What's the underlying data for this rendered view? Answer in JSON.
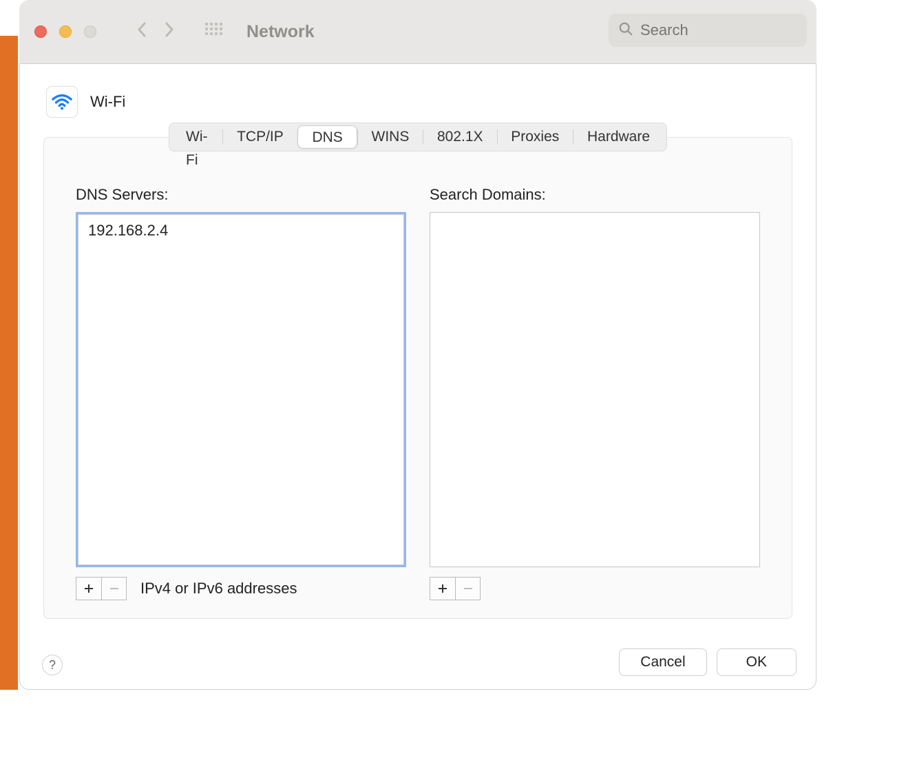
{
  "window": {
    "title": "Network",
    "search_placeholder": "Search"
  },
  "header": {
    "interface_label": "Wi-Fi"
  },
  "tabs": [
    "Wi-Fi",
    "TCP/IP",
    "DNS",
    "WINS",
    "802.1X",
    "Proxies",
    "Hardware"
  ],
  "active_tab_index": 2,
  "dns": {
    "servers_label": "DNS Servers:",
    "servers": [
      "192.168.2.4"
    ],
    "hint": "IPv4 or IPv6 addresses",
    "domains_label": "Search Domains:",
    "domains": []
  },
  "footer": {
    "cancel": "Cancel",
    "ok": "OK"
  }
}
